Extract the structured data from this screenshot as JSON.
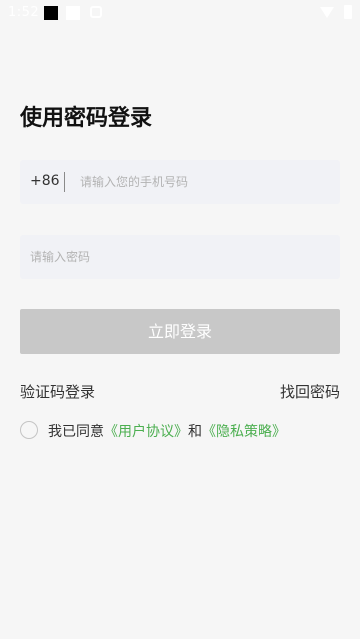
{
  "status_bar": {
    "time": "1:52",
    "icons": [
      "notification-square-icon",
      "square-icon",
      "bell-icon",
      "wifi-icon",
      "battery-icon"
    ]
  },
  "page": {
    "title": "使用密码登录"
  },
  "phone": {
    "country_code": "+86",
    "placeholder": "请输入您的手机号码",
    "value": ""
  },
  "password": {
    "placeholder": "请输入密码",
    "value": ""
  },
  "login_button": {
    "label": "立即登录"
  },
  "links": {
    "sms_login": "验证码登录",
    "forgot_password": "找回密码"
  },
  "agreement": {
    "prefix": "我已同意",
    "user_agreement": "《用户协议》",
    "and": "和",
    "privacy_policy": "《隐私策略》",
    "checked": false
  },
  "colors": {
    "background": "#f6f6f6",
    "field_background": "#f1f2f6",
    "button_disabled": "#c8c8c8",
    "link_green": "#4caf50",
    "text_primary": "#111111"
  }
}
